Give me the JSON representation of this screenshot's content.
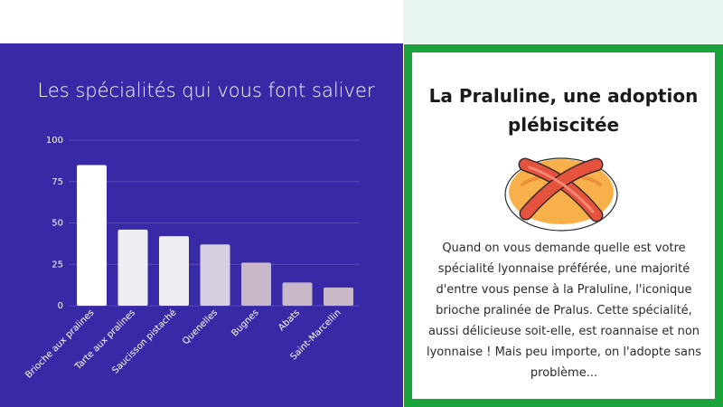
{
  "colors": {
    "panel_bg": "#3829a6",
    "card_border": "#1aa33a",
    "bar_highlight": "#ffffff",
    "bar_light": "#f0eef5",
    "bar_mid": "#d7cfe0",
    "bar_muted": "#c8b8c8"
  },
  "chart_data": {
    "type": "bar",
    "title": "Les spécialités qui vous font saliver",
    "categories": [
      "Brioche aux pralines",
      "Tarte aux pralines",
      "Saucisson pistaché",
      "Quenelles",
      "Bugnes",
      "Abats",
      "Saint-Marcellin"
    ],
    "values": [
      85,
      46,
      42,
      37,
      26,
      14,
      11
    ],
    "yticks": [
      "0",
      "25",
      "50",
      "75",
      "100"
    ],
    "ylim": [
      0,
      100
    ],
    "grid": true,
    "legend": "none"
  },
  "card": {
    "title": "La Praluline, une adoption plébiscitée",
    "body": "Quand on vous demande quelle est votre spécialité lyonnaise préférée, une majorité d'entre vous pense à la Praluline, l'iconique brioche pralinée de Pralus. Cette spécialité, aussi délicieuse soit-elle, est roannaise et non lyonnaise ! Mais peu importe, on l'adopte sans problème..."
  }
}
